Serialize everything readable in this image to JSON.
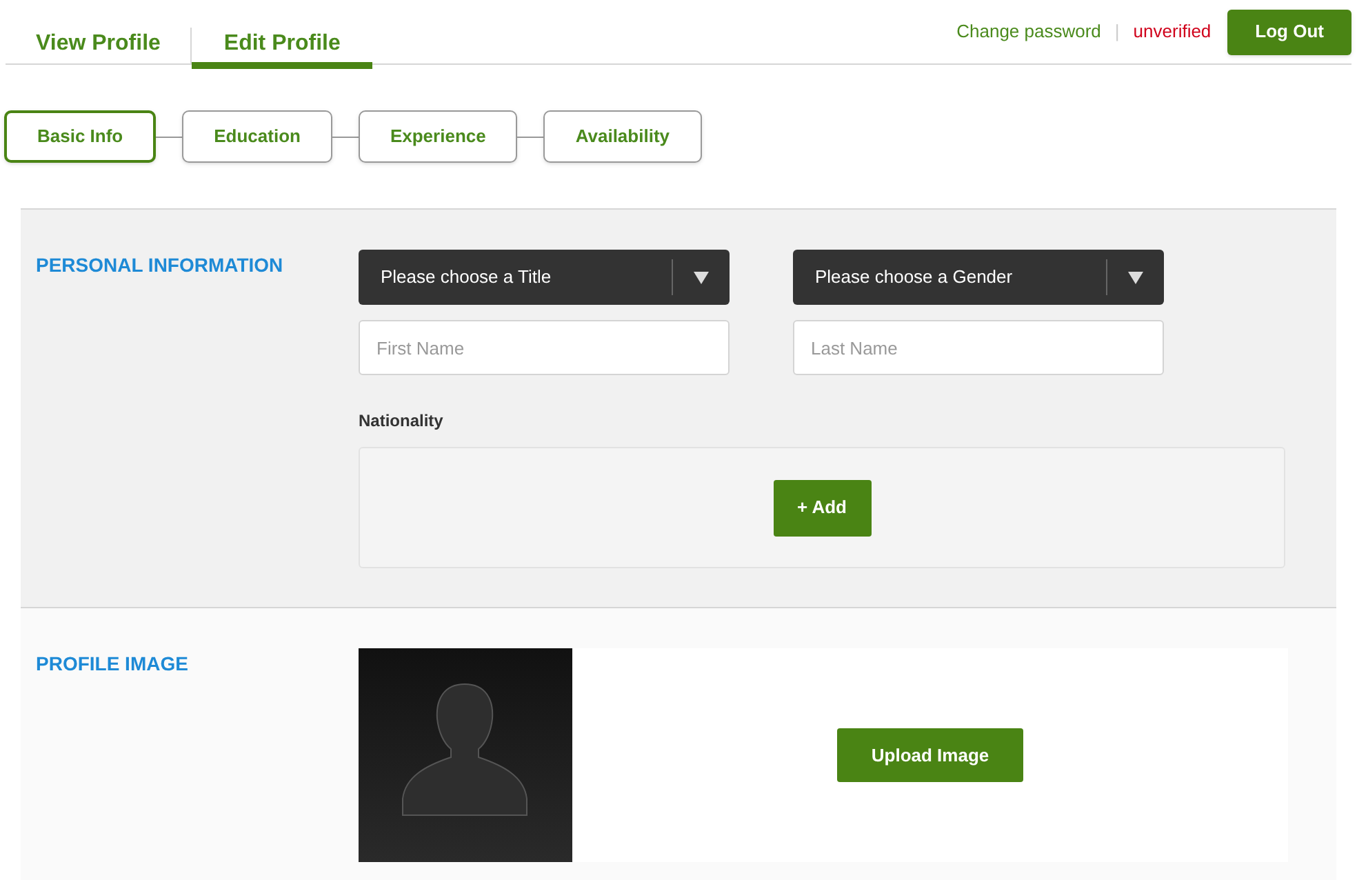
{
  "nav_tabs": [
    {
      "label": "View Profile",
      "selected": false
    },
    {
      "label": "Edit Profile",
      "selected": true
    }
  ],
  "account": {
    "change_password": "Change password",
    "separator": "|",
    "status": "unverified",
    "logout": "Log Out"
  },
  "steps": [
    {
      "label": "Basic Info",
      "selected": true
    },
    {
      "label": "Education",
      "selected": false
    },
    {
      "label": "Experience",
      "selected": false
    },
    {
      "label": "Availability",
      "selected": false
    }
  ],
  "personal_information": {
    "heading": "PERSONAL INFORMATION",
    "title_select": "Please choose a Title",
    "gender_select": "Please choose a Gender",
    "first_name": {
      "placeholder": "First Name"
    },
    "last_name": {
      "placeholder": "Last Name"
    },
    "nationality_label": "Nationality",
    "add_button": "+ Add"
  },
  "profile_image": {
    "heading": "PROFILE IMAGE",
    "upload_button": "Upload Image"
  }
}
